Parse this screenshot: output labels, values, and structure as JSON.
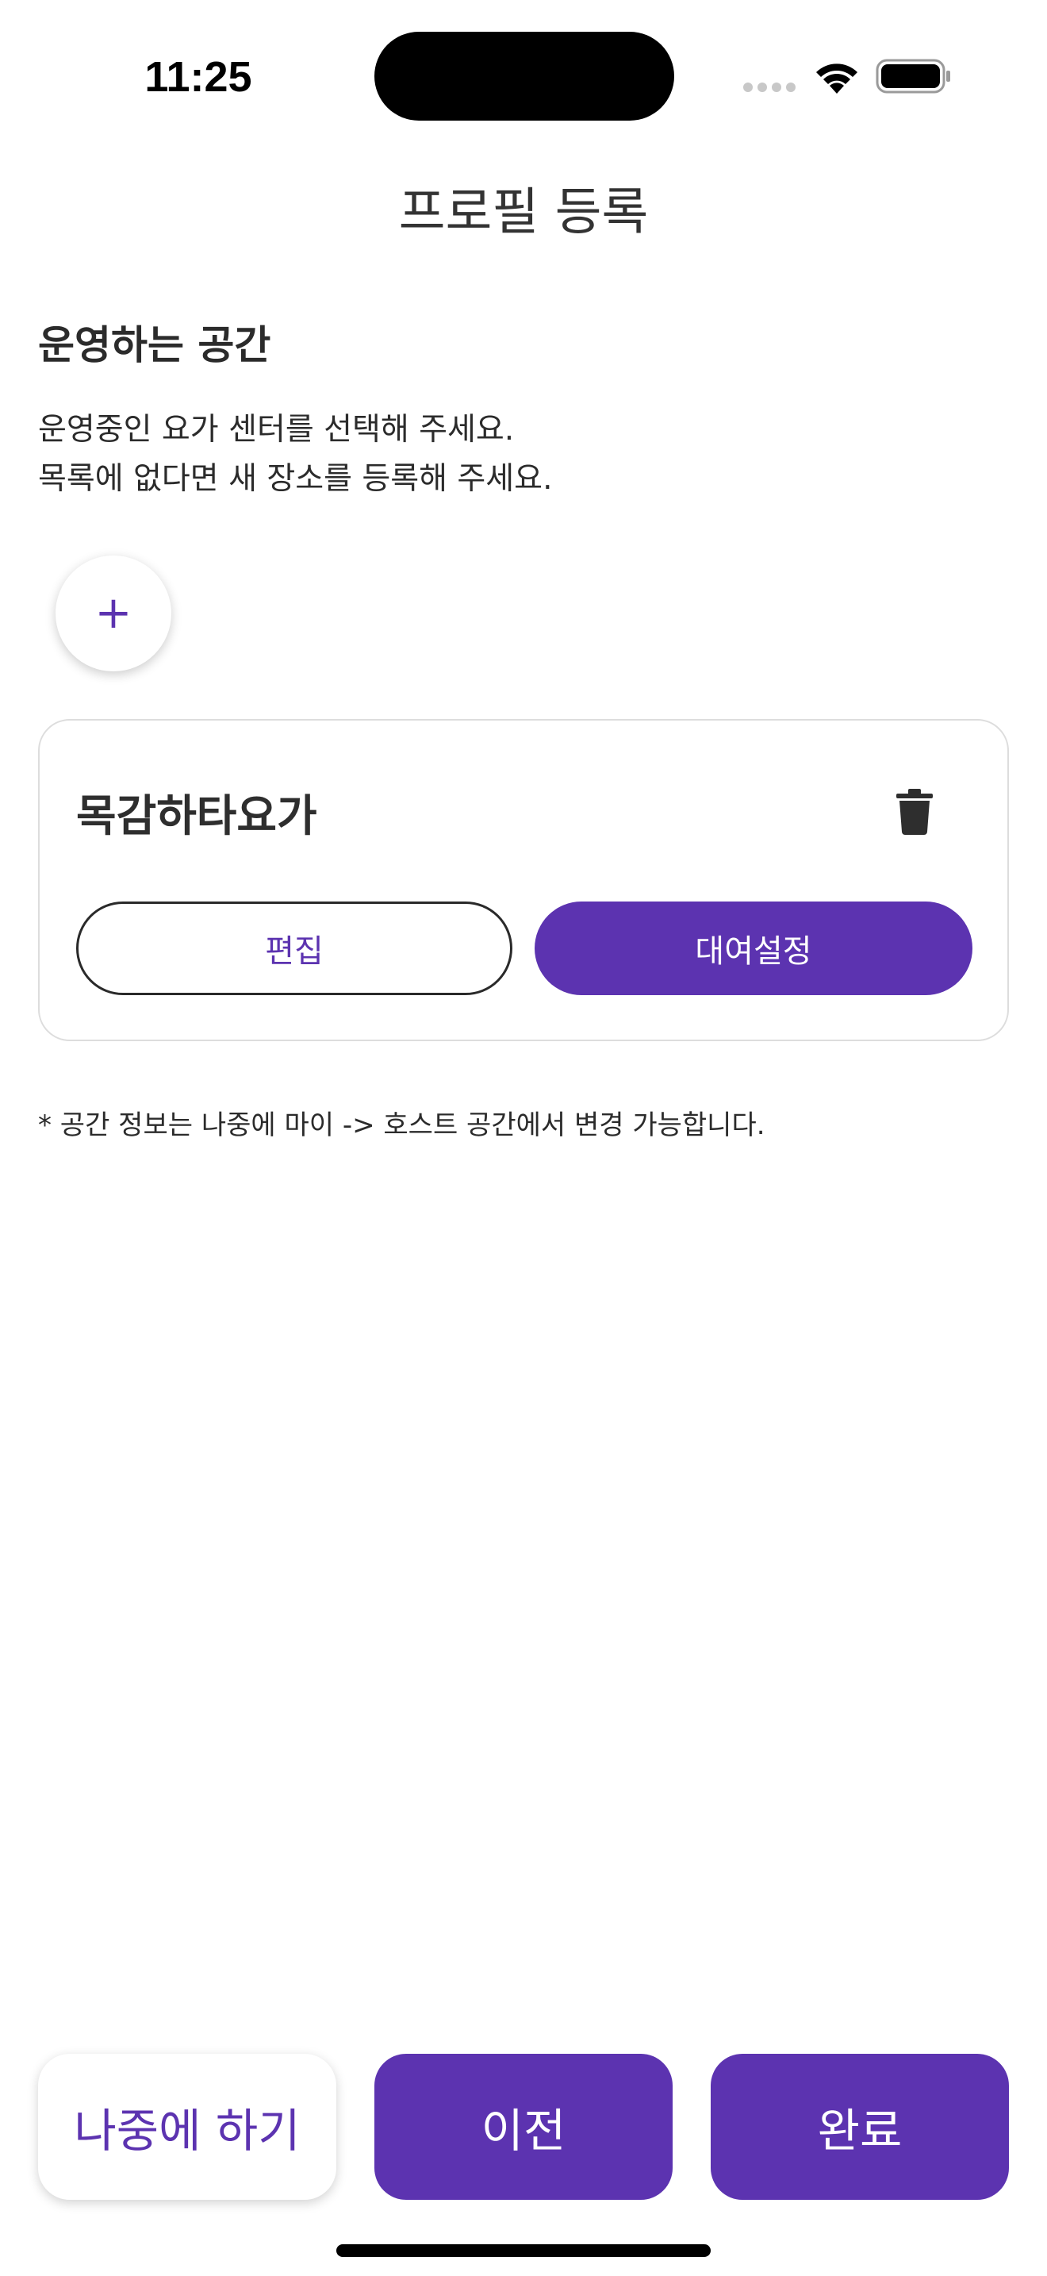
{
  "status_bar": {
    "time": "11:25"
  },
  "header": {
    "title": "프로필 등록"
  },
  "section": {
    "title": "운영하는 공간",
    "description_line1": "운영중인 요가 센터를 선택해 주세요.",
    "description_line2": "목록에 없다면 새 장소를 등록해 주세요.",
    "add_icon": "plus-icon",
    "add_symbol": "+"
  },
  "spaces": [
    {
      "name": "목감하타요가",
      "delete_icon": "trash-icon",
      "edit_label": "편집",
      "rent_label": "대여설정"
    }
  ],
  "footnote": "* 공간 정보는 나중에 마이 -> 호스트 공간에서 변경 가능합니다.",
  "footer": {
    "later_label": "나중에 하기",
    "prev_label": "이전",
    "done_label": "완료"
  },
  "colors": {
    "accent": "#5c33b0",
    "text": "#2b2b2b",
    "border": "#dddddd"
  }
}
